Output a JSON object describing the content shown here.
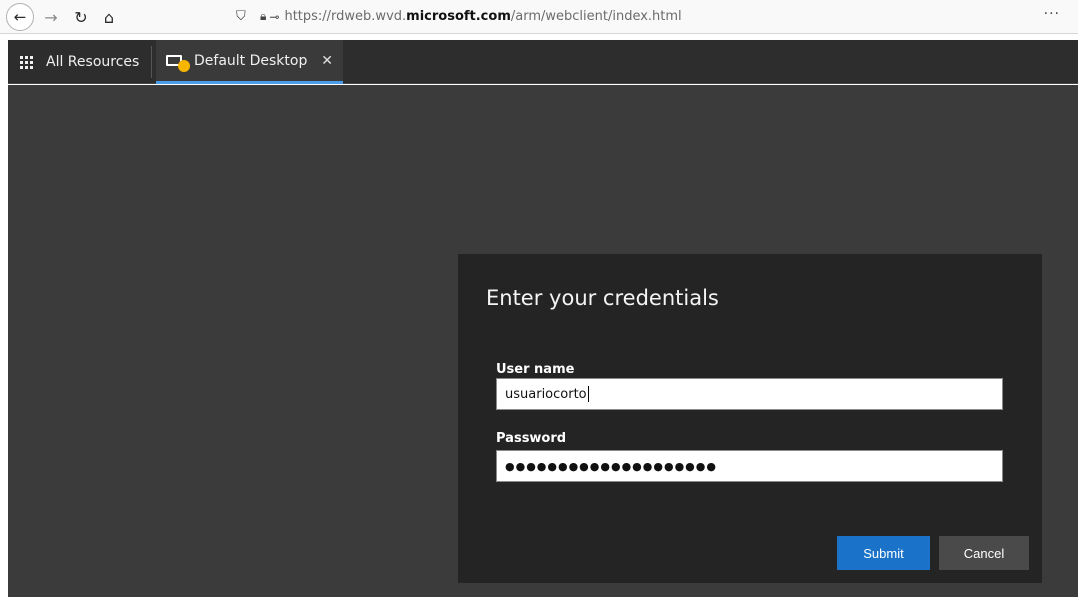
{
  "browser": {
    "url_prefix": "https://rdweb.wvd.",
    "url_host": "microsoft.com",
    "url_path": "/arm/webclient/index.html",
    "more_label": "···"
  },
  "rd_bar": {
    "all_resources_label": "All Resources",
    "tab_label": "Default Desktop",
    "tab_close": "✕"
  },
  "dialog": {
    "title": "Enter your credentials",
    "username_label": "User name",
    "username_value": "usuariocorto",
    "password_label": "Password",
    "password_mask": "●●●●●●●●●●●●●●●●●●●●",
    "submit_label": "Submit",
    "cancel_label": "Cancel"
  },
  "colors": {
    "accent": "#1a73c8",
    "tab_underline": "#4a9be8",
    "rd_bar_bg": "#2d2d2d",
    "dialog_bg": "#242424"
  }
}
